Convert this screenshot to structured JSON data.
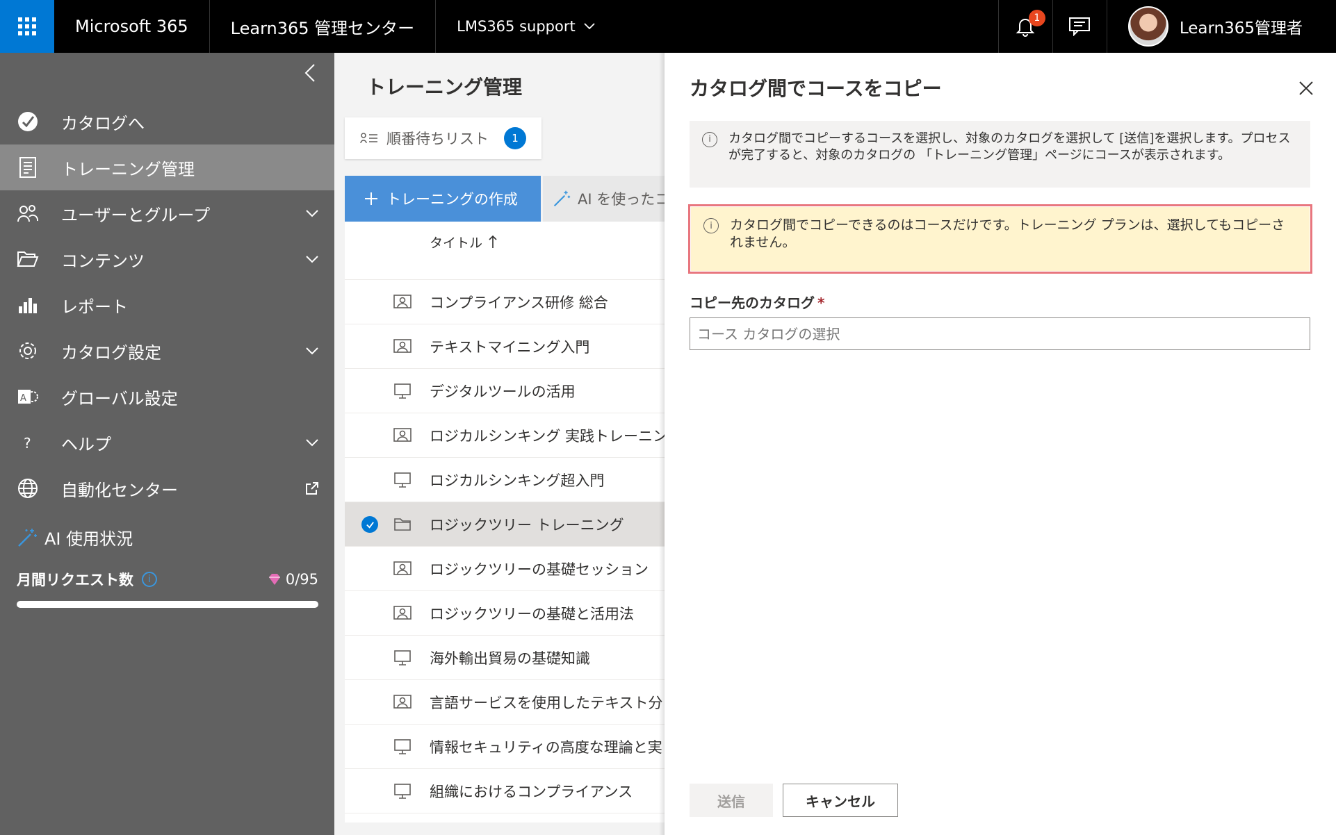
{
  "topbar": {
    "brand": "Microsoft 365",
    "app_title": "Learn365 管理センター",
    "org_selector": "LMS365 support",
    "notification_count": "1",
    "user_name": "Learn365管理者"
  },
  "sidebar": {
    "items": [
      {
        "label": "カタログへ",
        "icon": "catalog-arrow-icon",
        "chevron": false
      },
      {
        "label": "トレーニング管理",
        "icon": "training-doc-icon",
        "chevron": false,
        "active": true
      },
      {
        "label": "ユーザーとグループ",
        "icon": "users-icon",
        "chevron": true
      },
      {
        "label": "コンテンツ",
        "icon": "folder-open-icon",
        "chevron": true
      },
      {
        "label": "レポート",
        "icon": "bar-chart-icon",
        "chevron": false
      },
      {
        "label": "カタログ設定",
        "icon": "gear-icon",
        "chevron": true
      },
      {
        "label": "グローバル設定",
        "icon": "global-settings-icon",
        "chevron": false
      },
      {
        "label": "ヘルプ",
        "icon": "question-icon",
        "chevron": true
      },
      {
        "label": "自動化センター",
        "icon": "globe-icon",
        "chevron": false,
        "external": true
      }
    ],
    "ai_usage": {
      "title": "AI 使用状況",
      "monthly_requests_label": "月間リクエスト数",
      "count": "0/95",
      "progress": 0
    }
  },
  "main": {
    "page_title": "トレーニング管理",
    "queue_label": "順番待ちリスト",
    "queue_count": "1",
    "create_button": "トレーニングの作成",
    "ai_button": "AI を使ったコ",
    "column_title": "タイトル",
    "rows": [
      {
        "title": "コンプライアンス研修 総合",
        "icon": "classroom-icon"
      },
      {
        "title": "テキストマイニング入門",
        "icon": "classroom-icon"
      },
      {
        "title": "デジタルツールの活用",
        "icon": "monitor-icon"
      },
      {
        "title": "ロジカルシンキング 実践トレーニン",
        "icon": "classroom-icon"
      },
      {
        "title": "ロジカルシンキング超入門",
        "icon": "monitor-icon"
      },
      {
        "title": "ロジックツリー トレーニング",
        "icon": "folder-icon",
        "selected": true
      },
      {
        "title": "ロジックツリーの基礎セッション",
        "icon": "classroom-icon"
      },
      {
        "title": "ロジックツリーの基礎と活用法",
        "icon": "classroom-icon"
      },
      {
        "title": "海外輸出貿易の基礎知識",
        "icon": "monitor-icon"
      },
      {
        "title": "言語サービスを使用したテキスト分",
        "icon": "classroom-icon"
      },
      {
        "title": "情報セキュリティの高度な理論と実",
        "icon": "monitor-icon"
      },
      {
        "title": "組織におけるコンプライアンス",
        "icon": "monitor-icon"
      }
    ]
  },
  "panel": {
    "title": "カタログ間でコースをコピー",
    "info_text": "カタログ間でコピーするコースを選択し、対象のカタログを選択して [送信]を選択します。プロセスが完了すると、対象のカタログの 「トレーニング管理」ページにコースが表示されます。",
    "warning_text": "カタログ間でコピーできるのはコースだけです。トレーニング プランは、選択してもコピーされません。",
    "field_label": "コピー先のカタログ",
    "field_placeholder": "コース カタログの選択",
    "submit_label": "送信",
    "cancel_label": "キャンセル"
  },
  "colors": {
    "accent": "#0078d4",
    "topbar": "#000000",
    "sidebar": "#616161",
    "warning_bg": "#fff4ce",
    "highlight_outline": "#e8767e"
  }
}
